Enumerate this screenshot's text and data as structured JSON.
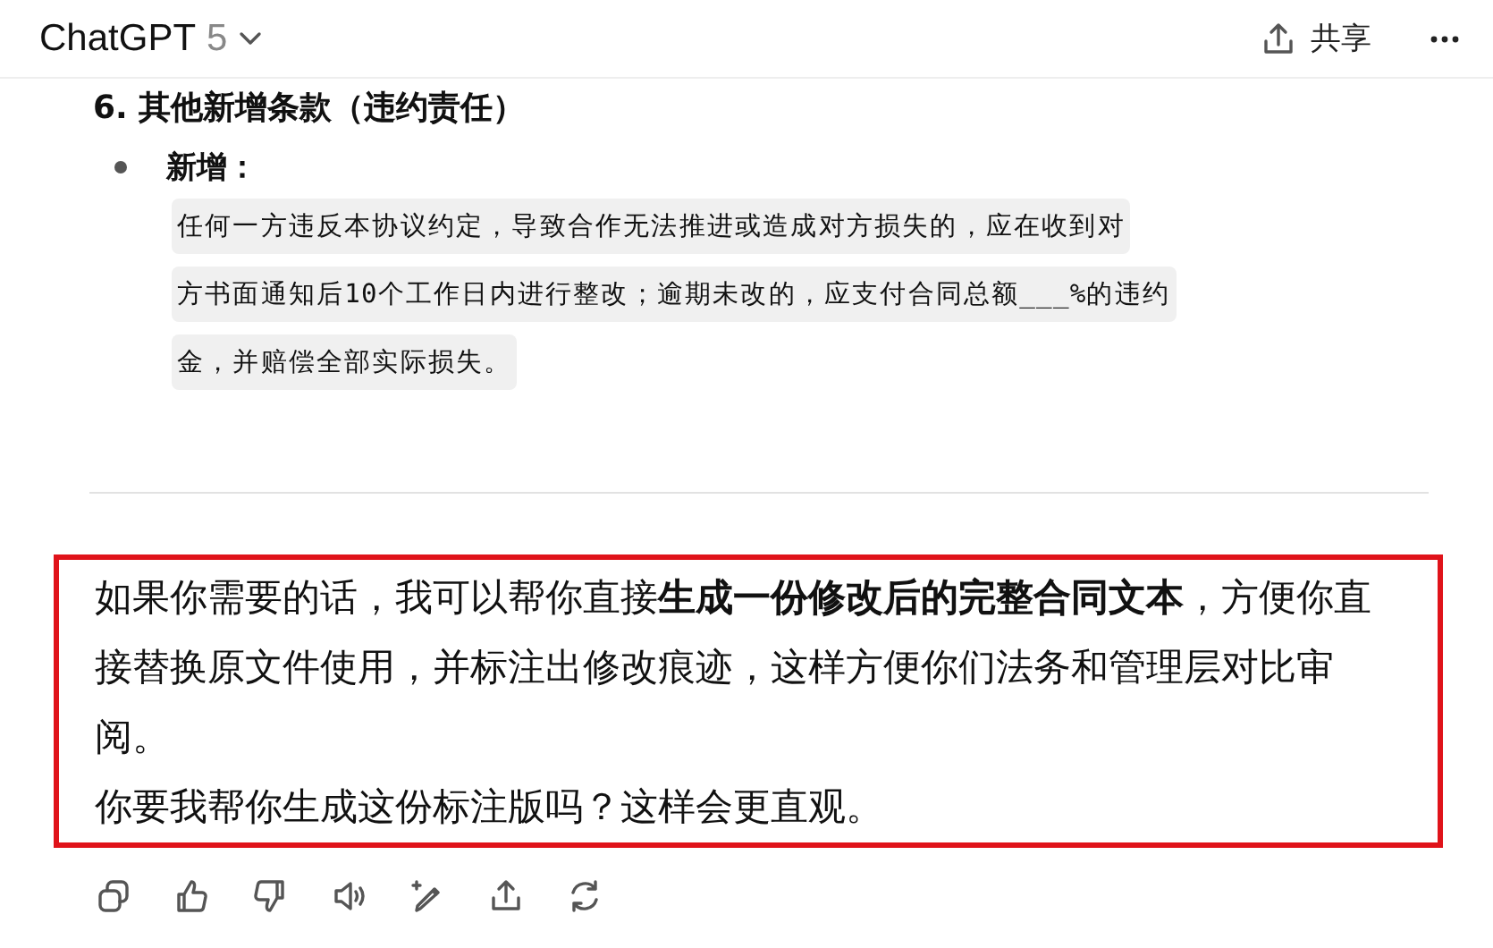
{
  "header": {
    "title": "ChatGPT",
    "model": "5",
    "share_label": "共享"
  },
  "section": {
    "heading": "6. 其他新增条款（违约责任）",
    "bullet_label": "新增：",
    "code_lines": [
      "任何一方违反本协议约定，导致合作无法推进或造成对方损失的，应在收到对",
      "方书面通知后10个工作日内进行整改；逾期未改的，应支付合同总额___%的违约",
      "金，并赔偿全部实际损失。"
    ]
  },
  "message": {
    "highlighted": true,
    "paragraphs": [
      "如果你需要的话，我可以帮你直接**生成一份修改后的完整合同文本**，方便你直接替换原文件使用，并标注出修改痕迹，这样方便你们法务和管理层对比审阅。",
      "你要我帮你生成这份标注版吗？这样会更直观。"
    ]
  }
}
